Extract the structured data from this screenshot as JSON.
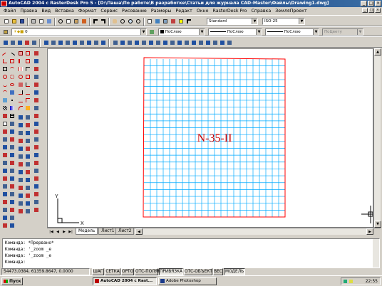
{
  "window": {
    "title": "AutoCAD 2004 с RasterDesk Pro 5 - [D:\\Паша\\По работе\\В разработке\\Статьи для журнала CAD-Master\\Файлы\\Drawing1.dwg]",
    "buttons": [
      "_",
      "□",
      "×"
    ]
  },
  "menu": {
    "items": [
      "Файл",
      "Правка",
      "Вид",
      "Вставка",
      "Формат",
      "Сервис",
      "Рисование",
      "Размеры",
      "Редакт",
      "Окно",
      "RasterDesk Pro",
      "Справка",
      "ЗемляПроект"
    ]
  },
  "toolbars": {
    "text_style": "Standard",
    "dim_style": "ISO-25",
    "layer": "0",
    "color": "ПоСлою",
    "linetype": "ПоСлою",
    "lineweight": "ПоСлою",
    "plotstyle": "ПоЦвету"
  },
  "drawing": {
    "sheet_label": "N-35-II",
    "ucs_x": "X",
    "ucs_y": "Y",
    "grid_color": "#00aaff",
    "border_color": "#ff0000",
    "label_color": "#cc0000"
  },
  "tabs": {
    "items": [
      "Модель",
      "Лист1",
      "Лист2"
    ],
    "active": 0
  },
  "command": {
    "lines": [
      "Команда: *Прервано*",
      "Команда: '_zoom _e",
      "Команда: '_zoom _e",
      "Команда:"
    ]
  },
  "status": {
    "coords": "54473.0384, 61359.8647, 0.0000",
    "buttons": [
      "ШАГ",
      "СЕТКА",
      "ОРТО",
      "ОТС-ПОЛЯР",
      "ПРИВЯЗКА",
      "ОТС-ОБЪЕКТ",
      "ВЕС",
      "МОДЕЛЬ"
    ],
    "on": [
      "ПРИВЯЗКА",
      "МОДЕЛЬ"
    ]
  },
  "taskbar": {
    "start": "Пуск",
    "items": [
      "AutoCAD 2004 с Rast...",
      "Adobe Photoshop"
    ],
    "clock": "22:55"
  }
}
